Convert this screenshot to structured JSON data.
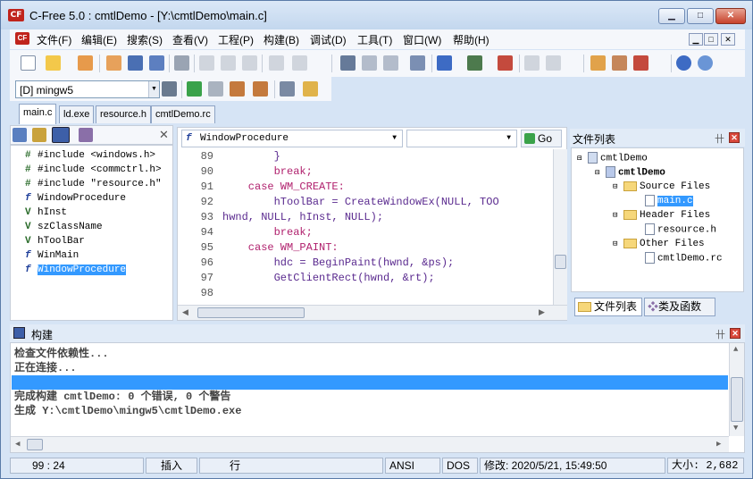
{
  "window": {
    "title": "C-Free 5.0 : cmtlDemo - [Y:\\cmtlDemo\\main.c]",
    "minimize": "▁",
    "maximize": "□",
    "close": "✕"
  },
  "app_icon_text": "CF",
  "menu": [
    "文件(F)",
    "编辑(E)",
    "搜索(S)",
    "查看(V)",
    "工程(P)",
    "构建(B)",
    "调试(D)",
    "工具(T)",
    "窗口(W)",
    "帮助(H)"
  ],
  "compiler": {
    "value": "[D] mingw5"
  },
  "file_tabs": [
    "main.c",
    "ld.exe",
    "resource.h",
    "cmtlDemo.rc"
  ],
  "symbols": [
    {
      "icon": "#",
      "text": "#include <windows.h>"
    },
    {
      "icon": "#",
      "text": "#include <commctrl.h>"
    },
    {
      "icon": "#",
      "text": "#include \"resource.h\""
    },
    {
      "icon": "f",
      "text": "WindowProcedure"
    },
    {
      "icon": "V",
      "text": "hInst"
    },
    {
      "icon": "V",
      "text": "szClassName"
    },
    {
      "icon": "V",
      "text": "hToolBar"
    },
    {
      "icon": "f",
      "text": "WinMain"
    },
    {
      "icon": "f",
      "text": "WindowProcedure"
    }
  ],
  "code_nav": {
    "function": "WindowProcedure",
    "go": "Go"
  },
  "code_lines": [
    {
      "n": "89",
      "text": "        }"
    },
    {
      "n": "90",
      "text": "        break;"
    },
    {
      "n": "91",
      "text": "    case WM_CREATE:"
    },
    {
      "n": "92",
      "text": "        hToolBar = CreateWindowEx(NULL, TOO"
    },
    {
      "n": "93",
      "text": "hwnd, NULL, hInst, NULL);"
    },
    {
      "n": "94",
      "text": "        break;"
    },
    {
      "n": "95",
      "text": "    case WM_PAINT:"
    },
    {
      "n": "96",
      "text": "        hdc = BeginPaint(hwnd, &ps);"
    },
    {
      "n": "97",
      "text": "        GetClientRect(hwnd, &rt);"
    },
    {
      "n": "98",
      "text": ""
    }
  ],
  "file_panel": {
    "title": "文件列表",
    "tree": [
      {
        "label": "cmtlDemo",
        "kind": "root"
      },
      {
        "label": "cmtlDemo",
        "kind": "project"
      },
      {
        "label": "Source Files",
        "kind": "folder"
      },
      {
        "label": "main.c",
        "kind": "file"
      },
      {
        "label": "Header Files",
        "kind": "folder"
      },
      {
        "label": "resource.h",
        "kind": "file"
      },
      {
        "label": "Other Files",
        "kind": "folder"
      },
      {
        "label": "cmtlDemo.rc",
        "kind": "file"
      }
    ],
    "tabs": [
      "文件列表",
      "类及函数"
    ]
  },
  "build_panel": {
    "title": "构建",
    "lines": [
      "检查文件依赖性...",
      "正在连接...",
      "",
      "完成构建 cmtlDemo: 0 个错误, 0 个警告",
      "生成 Y:\\cmtlDemo\\mingw5\\cmtlDemo.exe"
    ]
  },
  "status": {
    "position": "99 : 24",
    "mode": "插入",
    "unit": "行",
    "encoding": "ANSI",
    "lineend": "DOS",
    "modified": "修改: 2020/5/21, 15:49:50",
    "size": "大小: 2,682"
  },
  "colors": {
    "selection": "#3399ff",
    "keyword": "#b0206d",
    "frame": "#d6e4f5"
  }
}
